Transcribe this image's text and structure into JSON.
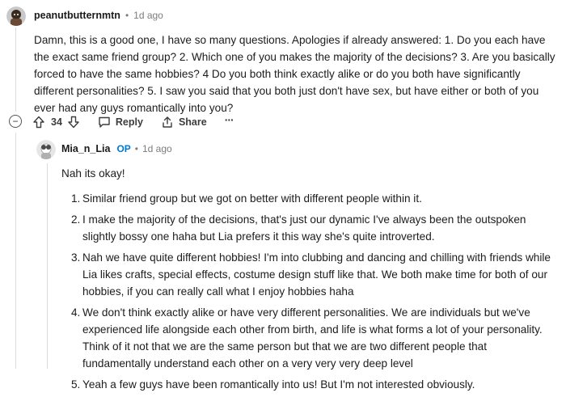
{
  "comment": {
    "author": "peanutbutternmtn",
    "separator": "•",
    "age": "1d ago",
    "body": "Damn, this is a good one, I have so many questions. Apologies if already answered: 1. Do you each have the exact same friend group? 2. Which one of you makes the majority of the decisions? 3. Are you basically forced to have the same hobbies? 4 Do you both think exactly alike or do you both have significantly different personalities? 5. I saw you said that you both just don't have sex, but have either or both of you ever had any guys romantically into you?",
    "vote_count": "34",
    "reply_label": "Reply",
    "share_label": "Share",
    "more_label": "···",
    "collapse_label": "−"
  },
  "reply": {
    "author": "Mia_n_Lia",
    "op_badge": "OP",
    "separator": "•",
    "age": "1d ago",
    "intro": "Nah its okay!",
    "items": [
      {
        "num": "1.",
        "text": "Similar friend group but we got on better with different people within it."
      },
      {
        "num": "2.",
        "text": "I make the majority of the decisions, that's just our dynamic I've always been the outspoken slightly bossy one haha but Lia prefers it this way she's quite introverted."
      },
      {
        "num": "3.",
        "text": "Nah we have quite different hobbies! I'm into clubbing and dancing and chilling with friends while Lia likes crafts, special effects, costume design stuff like that. We both make time for both of our hobbies, if you can really call what I enjoy hobbies haha"
      },
      {
        "num": "4.",
        "text": "We don't think exactly alike or have very different personalities. We are individuals but we've experienced life alongside each other from birth, and life is what forms a lot of your personality. Think of it not that we are the same person but that we are two different people that fundamentally understand each other on a very very very deep level"
      },
      {
        "num": "5.",
        "text": "Yeah a few guys have been romantically into us! But I'm not interested obviously."
      }
    ]
  },
  "colors": {
    "op_badge": "#0079d3",
    "thread_line": "#d9dde0",
    "meta": "#7c7c7c"
  },
  "icons": [
    "avatar",
    "collapse-icon",
    "upvote-icon",
    "downvote-icon",
    "comment-bubble-icon",
    "share-icon",
    "more-icon",
    "reply-avatar"
  ]
}
